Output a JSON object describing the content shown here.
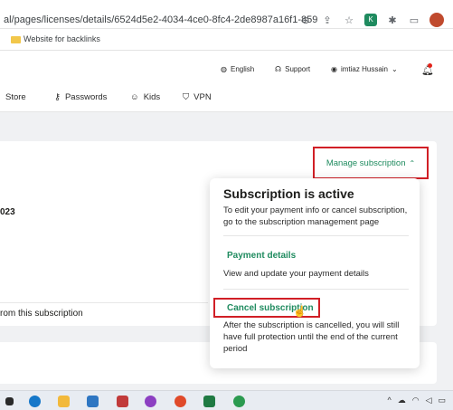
{
  "browser": {
    "url": "al/pages/licenses/details/6524d5e2-4034-4ce0-8fc4-2de8987a16f1-859",
    "bookmark_label": "Website for backlinks"
  },
  "top_nav": {
    "language": "English",
    "support": "Support",
    "user": "imtiaz Hussain"
  },
  "menu": {
    "store": "Store",
    "passwords": "Passwords",
    "kids": "Kids",
    "vpn": "VPN"
  },
  "card": {
    "year_fragment": "023",
    "manage_label": "Manage subscription",
    "from_subscription": "rom this subscription"
  },
  "dropdown": {
    "title": "Subscription is active",
    "description": "To edit your payment info or cancel subscription, go to the subscription management page",
    "payment_link": "Payment details",
    "payment_desc": "View and update your payment details",
    "cancel_link": "Cancel subscription",
    "cancel_desc": "After the subscription is cancelled, you will still have full protection until the end of the current period"
  },
  "colors": {
    "accent_green": "#1f8b5f",
    "highlight_red": "#d11f26"
  }
}
